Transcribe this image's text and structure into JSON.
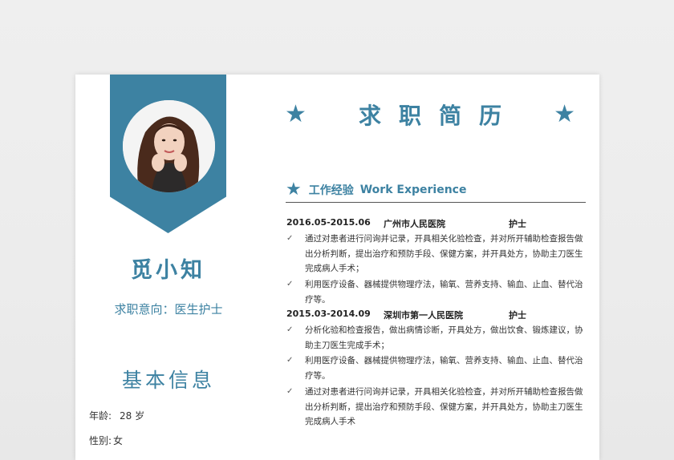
{
  "profile": {
    "name": "觅小知",
    "intent": "求职意向：医生护士"
  },
  "resume_title": "求职简历",
  "basic_info": {
    "title": "基本信息",
    "rows": [
      {
        "label": "年龄:",
        "value": "28 岁"
      },
      {
        "label": "性别:",
        "value": "女"
      }
    ]
  },
  "work_experience": {
    "title_zh": "工作经验",
    "title_en": "Work Experience",
    "jobs": [
      {
        "period": "2016.05-2015.06",
        "company": "广州市人民医院",
        "role": "护士",
        "duties": [
          "通过对患者进行问询并记录，开具相关化验检查，并对所开辅助检查报告做出分析判断，提出治疗和预防手段、保健方案，并开具处方，协助主刀医生完成病人手术；",
          "利用医疗设备、器械提供物理疗法，输氧、营养支持、输血、止血、替代治疗等。"
        ]
      },
      {
        "period": "2015.03-2014.09",
        "company": "深圳市第一人民医院",
        "role": "护士",
        "duties": [
          "分析化验和检查报告，做出病情诊断，开具处方，做出饮食、锻炼建议，协助主刀医生完成手术；",
          "利用医疗设备、器械提供物理疗法，输氧、营养支持、输血、止血、替代治疗等。",
          "通过对患者进行问询并记录，开具相关化验检查，并对所开辅助检查报告做出分析判断，提出治疗和预防手段、保健方案，并开具处方，协助主刀医生完成病人手术"
        ]
      }
    ]
  },
  "icons": {
    "star": "★",
    "check": "✓"
  },
  "colors": {
    "accent": "#3d82a2",
    "text": "#333333",
    "background": "#ededed"
  }
}
